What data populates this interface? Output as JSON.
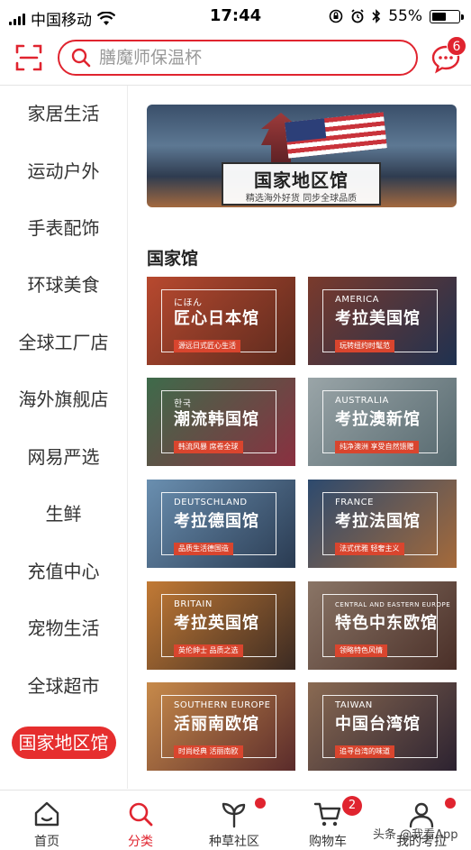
{
  "status_bar": {
    "carrier": "中国移动",
    "time": "17:44",
    "battery": "55%",
    "battery_level": 0.55
  },
  "search": {
    "placeholder": "膳魔师保温杯",
    "message_badge": "6"
  },
  "sidebar": {
    "items": [
      {
        "label": "家居生活"
      },
      {
        "label": "运动户外"
      },
      {
        "label": "手表配饰"
      },
      {
        "label": "环球美食"
      },
      {
        "label": "全球工厂店"
      },
      {
        "label": "海外旗舰店"
      },
      {
        "label": "网易严选"
      },
      {
        "label": "生鲜"
      },
      {
        "label": "充值中心"
      },
      {
        "label": "宠物生活"
      },
      {
        "label": "全球超市"
      },
      {
        "label": "国家地区馆",
        "active": true
      }
    ]
  },
  "banner": {
    "title": "国家地区馆",
    "subtitle": "精选海外好货   同步全球品质"
  },
  "section": {
    "title": "国家馆"
  },
  "tiles": [
    {
      "en": "にほん",
      "zh": "匠心日本馆",
      "tag": "源远日式匠心生活",
      "colors": [
        "#b8492f",
        "#5a2a1e"
      ]
    },
    {
      "en": "AMERICA",
      "zh": "考拉美国馆",
      "tag": "玩转纽约时髦范",
      "colors": [
        "#7a3a2c",
        "#1f3150"
      ]
    },
    {
      "en": "한국",
      "zh": "潮流韩国馆",
      "tag": "韩流风暴 席卷全球",
      "colors": [
        "#3e6b4b",
        "#8a3040"
      ]
    },
    {
      "en": "AUSTRALIA",
      "zh": "考拉澳新馆",
      "tag": "纯净澳洲 享受自然馈赠",
      "colors": [
        "#9aa5a8",
        "#55686e"
      ]
    },
    {
      "en": "DEUTSCHLAND",
      "zh": "考拉德国馆",
      "tag": "品质生活德国造",
      "colors": [
        "#6a8fb0",
        "#2a3b52"
      ]
    },
    {
      "en": "FRANCE",
      "zh": "考拉法国馆",
      "tag": "法式优雅 轻奢主义",
      "colors": [
        "#2d4a6e",
        "#a56a3a"
      ]
    },
    {
      "en": "BRITAIN",
      "zh": "考拉英国馆",
      "tag": "英伦绅士 品质之选",
      "colors": [
        "#c27a35",
        "#3b2a22"
      ]
    },
    {
      "en": "CENTRAL AND EASTERN EUROPE",
      "zh": "特色中东欧馆",
      "tag": "领略特色风情",
      "colors": [
        "#8a7566",
        "#4a2f28"
      ]
    },
    {
      "en": "SOUTHERN EUROPE",
      "zh": "活丽南欧馆",
      "tag": "时尚经典 活丽南欧",
      "colors": [
        "#c78a4a",
        "#5a2b2b"
      ]
    },
    {
      "en": "TAIWAN",
      "zh": "中国台湾馆",
      "tag": "追寻台湾的味道",
      "colors": [
        "#8a6a52",
        "#2c2230"
      ]
    }
  ],
  "tabbar": {
    "items": [
      {
        "label": "首页",
        "icon": "home-icon"
      },
      {
        "label": "分类",
        "icon": "search-icon",
        "active": true
      },
      {
        "label": "种草社区",
        "icon": "sprout-icon"
      },
      {
        "label": "购物车",
        "icon": "cart-icon",
        "badge": "2"
      },
      {
        "label": "我的考拉",
        "icon": "user-icon"
      }
    ]
  },
  "watermark": "头条 @我看App",
  "colors": {
    "accent": "#e0242f",
    "active_category": "#e62e2e"
  }
}
